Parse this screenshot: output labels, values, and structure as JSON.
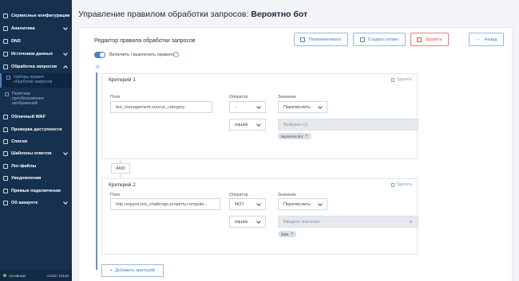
{
  "sidebar": {
    "items": [
      {
        "label": "Сервисные конфигурации",
        "chevron": false
      },
      {
        "label": "Аналитика",
        "chevron": true
      },
      {
        "label": "DNS",
        "chevron": false
      },
      {
        "label": "Источники данных",
        "chevron": true
      },
      {
        "label": "Обработка запросов",
        "chevron": true
      }
    ],
    "subitems": [
      {
        "label": "Наборы правил обработки запросов",
        "active": true
      },
      {
        "label": "Политики преобразования изображений",
        "active": false
      }
    ],
    "items_after": [
      {
        "label": "Облачный WAF",
        "chevron": false
      },
      {
        "label": "Проверка доступности",
        "chevron": false
      },
      {
        "label": "Списки",
        "chevron": false
      },
      {
        "label": "Шаблоны ответов",
        "chevron": true
      },
      {
        "label": "Лог-файлы",
        "chevron": false
      },
      {
        "label": "Уведомления",
        "chevron": false
      },
      {
        "label": "Прямые подключения",
        "chevron": false
      },
      {
        "label": "Об аккаунте",
        "chevron": true
      }
    ],
    "footer": {
      "status": "Активный",
      "account": "AccID: 13142"
    }
  },
  "header": {
    "title_prefix": "Управление правилом обработки запросов:",
    "title_name": "Вероятно бот"
  },
  "editor": {
    "title": "Редактор правила обработки запросов",
    "buttons": {
      "rename": "Переименовать",
      "copy": "Создать копию",
      "delete": "Удалить",
      "back": "Назад"
    },
    "toggle_label": "Включить / выключить правило",
    "toggle_on": true,
    "if_label": "IF"
  },
  "criteria": [
    {
      "title": "Критерий 1",
      "delete_label": "Удалить",
      "field_label": "Поле",
      "field_value": "bot_management.source_category",
      "operator_label": "Оператор",
      "operator_value": "-",
      "compare_value": "equals",
      "value_label": "Значение",
      "value_mode": "Перечислить",
      "multi_text": "Выбрано (1)",
      "chip": "Вероятно бот"
    },
    {
      "title": "Критерий 2",
      "delete_label": "Удалить",
      "field_label": "Поле",
      "field_value": "http.request.bot_challenge.property.compute...",
      "operator_label": "Оператор",
      "operator_value": "NOT",
      "compare_value": "equals",
      "value_label": "Значение",
      "value_mode": "Перечислить",
      "multi_text": "Введите значение",
      "chip": "false"
    }
  ],
  "connector": "AND",
  "add_criterion": "Добавить критерий"
}
